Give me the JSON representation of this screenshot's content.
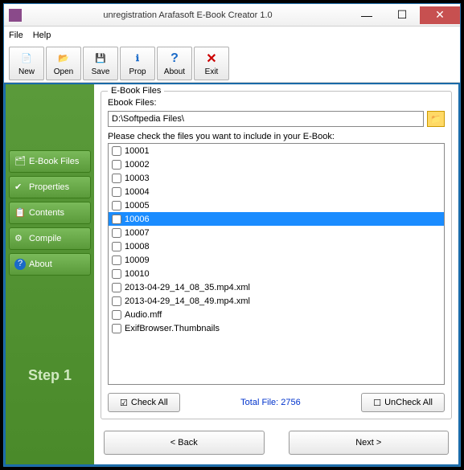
{
  "window": {
    "title": "unregistration Arafasoft E-Book Creator 1.0"
  },
  "menu": {
    "file": "File",
    "help": "Help"
  },
  "toolbar": {
    "new": "New",
    "open": "Open",
    "save": "Save",
    "prop": "Prop",
    "about": "About",
    "exit": "Exit"
  },
  "sidebar": {
    "ebook_files": "E-Book Files",
    "properties": "Properties",
    "contents": "Contents",
    "compile": "Compile",
    "about": "About",
    "step": "Step 1"
  },
  "group": {
    "legend": "E-Book Files",
    "path_label": "Ebook  Files:",
    "path_value": "D:\\Softpedia Files\\",
    "instruction": "Please check the files you want to include in your E-Book:",
    "files": [
      "10001",
      "10002",
      "10003",
      "10004",
      "10005",
      "10006",
      "10007",
      "10008",
      "10009",
      "10010",
      "2013-04-29_14_08_35.mp4.xml",
      "2013-04-29_14_08_49.mp4.xml",
      "Audio.mff",
      "ExifBrowser.Thumbnails"
    ],
    "selected_index": 5,
    "check_all": "Check All",
    "uncheck_all": "UnCheck All",
    "total_file": "Total File: 2756"
  },
  "nav": {
    "back": "< Back",
    "next": "Next >"
  }
}
